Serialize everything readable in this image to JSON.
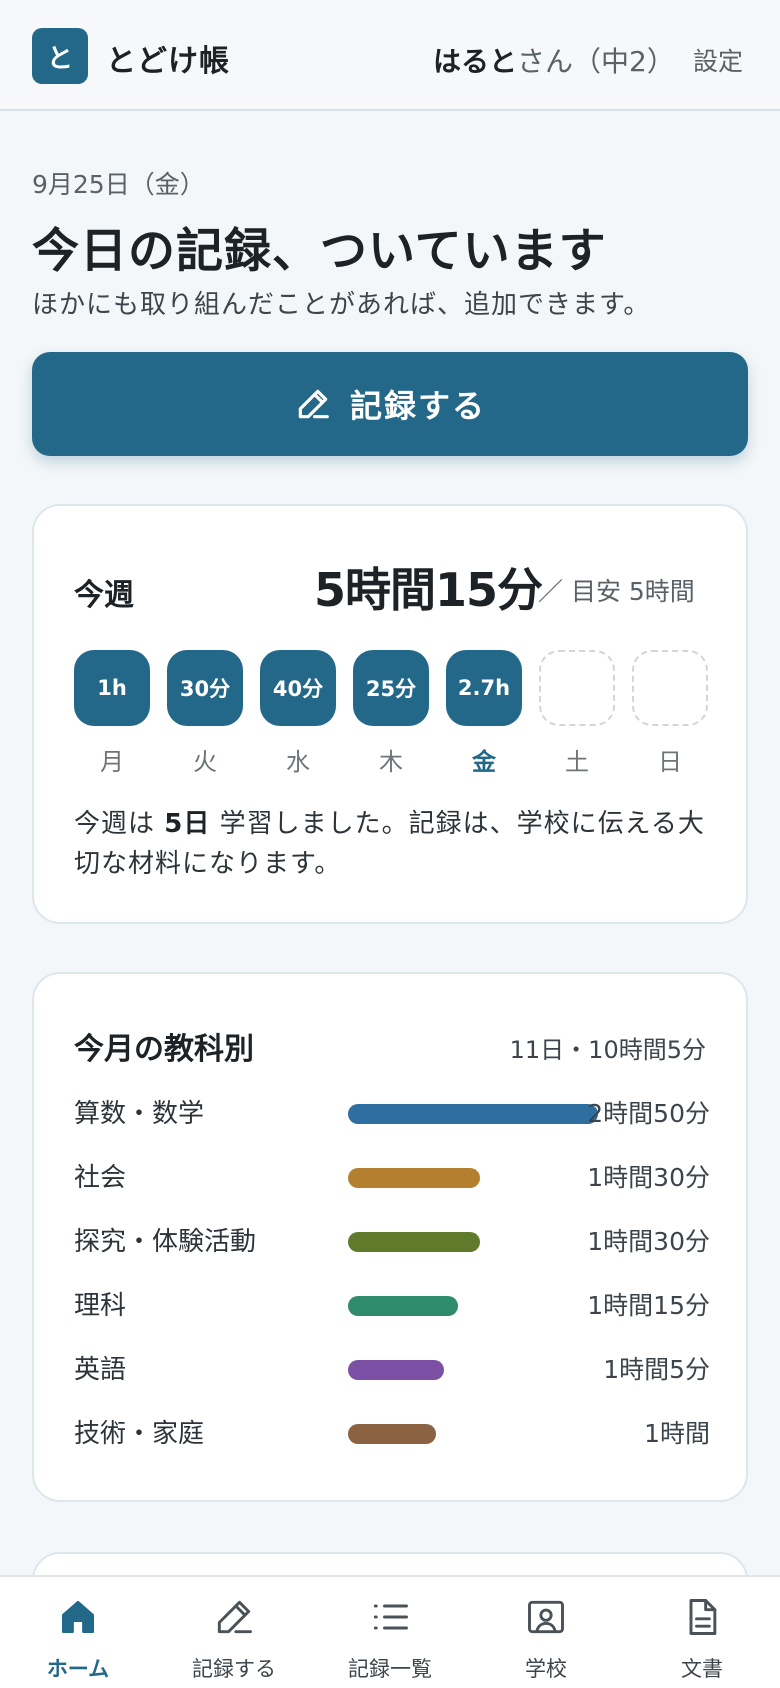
{
  "header": {
    "logo_char": "と",
    "app_name": "とどけ帳",
    "user_name": "はると",
    "user_suffix": "さん（中2）",
    "settings_label": "設定"
  },
  "intro": {
    "date": "9月25日（金）",
    "headline": "今日の記録、ついています",
    "subtext": "ほかにも取り組んだことがあれば、追加できます。"
  },
  "record_button": {
    "label": "記録する",
    "icon": "pencil-icon"
  },
  "week": {
    "title": "今週",
    "total": "5時間15分",
    "target": "／ 目安 5時間",
    "days": [
      {
        "label": "月",
        "value": "1h",
        "filled": true
      },
      {
        "label": "火",
        "value": "30分",
        "filled": true
      },
      {
        "label": "水",
        "value": "40分",
        "filled": true
      },
      {
        "label": "木",
        "value": "25分",
        "filled": true
      },
      {
        "label": "金",
        "value": "2.7h",
        "filled": true,
        "today": true
      },
      {
        "label": "土",
        "value": "",
        "filled": false
      },
      {
        "label": "日",
        "value": "",
        "filled": false
      }
    ],
    "note_pre": "今週は ",
    "note_days": "5日",
    "note_post": " 学習しました。記録は、学校に伝える大切な材料になります。"
  },
  "month": {
    "title": "今月の教科別",
    "summary": "11日・10時間5分",
    "subjects": [
      {
        "name": "算数・数学",
        "time": "2時間50分",
        "minutes": 170,
        "color": "#2f6fa0"
      },
      {
        "name": "社会",
        "time": "1時間30分",
        "minutes": 90,
        "color": "#b47f2e"
      },
      {
        "name": "探究・体験活動",
        "time": "1時間30分",
        "minutes": 90,
        "color": "#5f7a2b"
      },
      {
        "name": "理科",
        "time": "1時間15分",
        "minutes": 75,
        "color": "#2e8b6b"
      },
      {
        "name": "英語",
        "time": "1時間5分",
        "minutes": 65,
        "color": "#7b4fa3"
      },
      {
        "name": "技術・家庭",
        "time": "1時間",
        "minutes": 60,
        "color": "#8b6343"
      }
    ]
  },
  "nav": [
    {
      "label": "ホーム",
      "icon": "home-icon",
      "active": true
    },
    {
      "label": "記録する",
      "icon": "pencil-icon",
      "active": false
    },
    {
      "label": "記録一覧",
      "icon": "list-icon",
      "active": false
    },
    {
      "label": "学校",
      "icon": "school-board-icon",
      "active": false
    },
    {
      "label": "文書",
      "icon": "document-icon",
      "active": false
    }
  ],
  "colors": {
    "primary": "#236888",
    "background": "#f4f7f9"
  }
}
